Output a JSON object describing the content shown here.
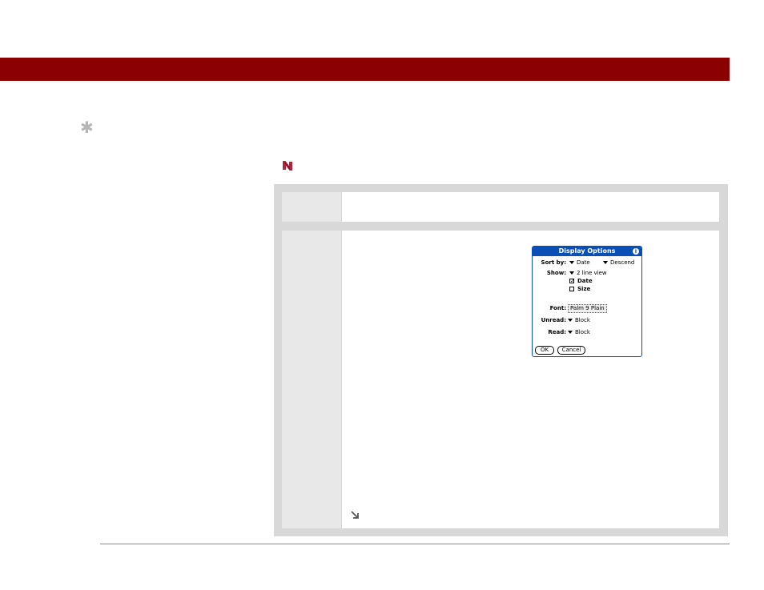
{
  "icons": {
    "tip": "asterisk-icon",
    "note": "note-icon",
    "continued": "arrow-down-right-icon"
  },
  "colors": {
    "header_bar": "#8b0000",
    "panel_bg": "#d8d8d8",
    "dialog_accent": "#0a4fb5"
  },
  "dialog": {
    "title": "Display Options",
    "sort_by_label": "Sort by:",
    "sort_by_value": "Date",
    "sort_order_value": "Descend",
    "show_label": "Show:",
    "show_value": "2 line view",
    "show_options": [
      {
        "label": "Date",
        "checked": true,
        "check_mark": "✓"
      },
      {
        "label": "Size",
        "checked": false,
        "check_mark": ""
      }
    ],
    "font_label": "Font:",
    "font_value": "Palm 9 Plain",
    "unread_label": "Unread:",
    "unread_value": "Block",
    "read_label": "Read:",
    "read_value": "Block",
    "ok_button": "OK",
    "cancel_button": "Cancel"
  }
}
